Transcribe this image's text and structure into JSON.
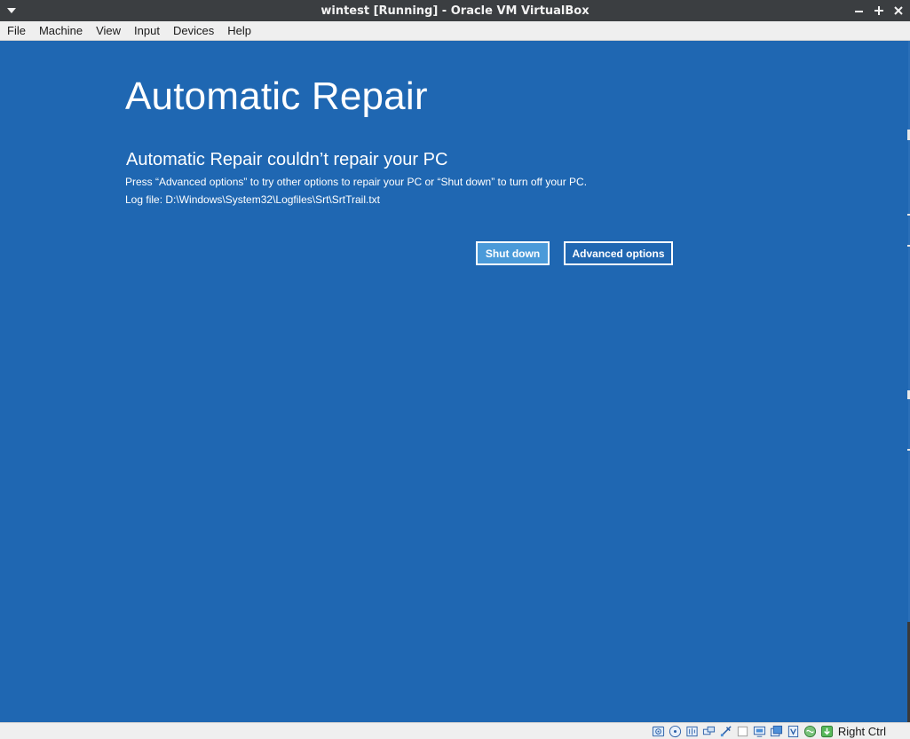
{
  "window": {
    "title": "wintest [Running] - Oracle VM VirtualBox",
    "controls": [
      "minimize-icon",
      "maximize-icon",
      "close-icon"
    ]
  },
  "menubar": {
    "items": [
      {
        "label": "File"
      },
      {
        "label": "Machine"
      },
      {
        "label": "View"
      },
      {
        "label": "Input"
      },
      {
        "label": "Devices"
      },
      {
        "label": "Help"
      }
    ]
  },
  "guest": {
    "background_color": "#1f67b2",
    "heading": "Automatic Repair",
    "subheading": "Automatic Repair couldn’t repair your PC",
    "description": "Press “Advanced options” to try other options to repair your PC or “Shut down” to turn off your PC.",
    "log_file": "Log file: D:\\Windows\\System32\\Logfiles\\Srt\\SrtTrail.txt",
    "buttons": {
      "shutdown_label": "Shut down",
      "advanced_label": "Advanced options"
    }
  },
  "statusbar": {
    "icons": [
      "hard-disk-icon",
      "optical-drive-icon",
      "audio-icon",
      "network-icon",
      "usb-icon",
      "shared-folders-icon",
      "display-icon",
      "video-capture-icon",
      "virtualization-icon",
      "mouse-integration-icon",
      "keyboard-capture-icon"
    ],
    "host_key": "Right Ctrl"
  }
}
